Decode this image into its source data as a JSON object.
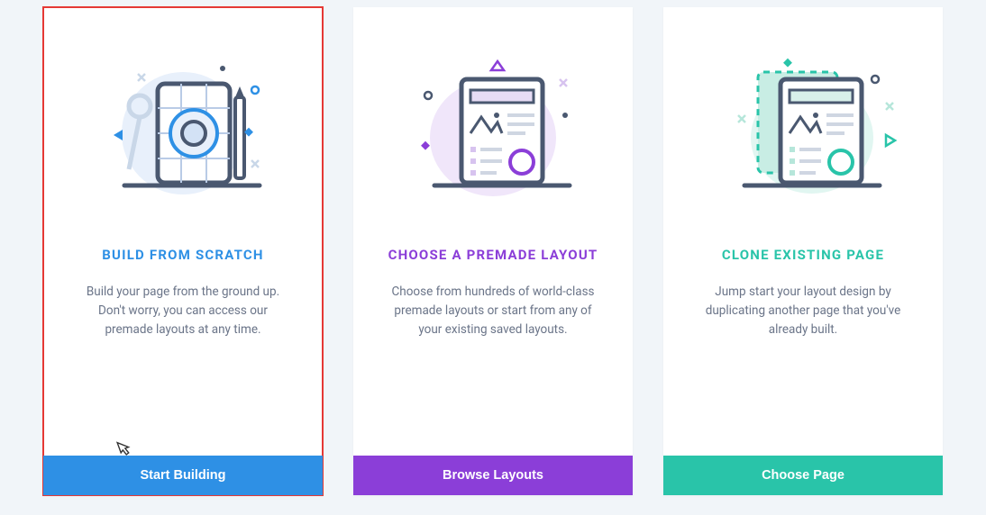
{
  "cards": [
    {
      "title": "BUILD FROM SCRATCH",
      "description": "Build your page from the ground up. Don't worry, you can access our premade layouts at any time.",
      "button": "Start Building",
      "accent": "blue"
    },
    {
      "title": "CHOOSE A PREMADE LAYOUT",
      "description": "Choose from hundreds of world-class premade layouts or start from any of your existing saved layouts.",
      "button": "Browse Layouts",
      "accent": "purple"
    },
    {
      "title": "CLONE EXISTING PAGE",
      "description": "Jump start your layout design by duplicating another page that you've already built.",
      "button": "Choose Page",
      "accent": "teal"
    }
  ]
}
